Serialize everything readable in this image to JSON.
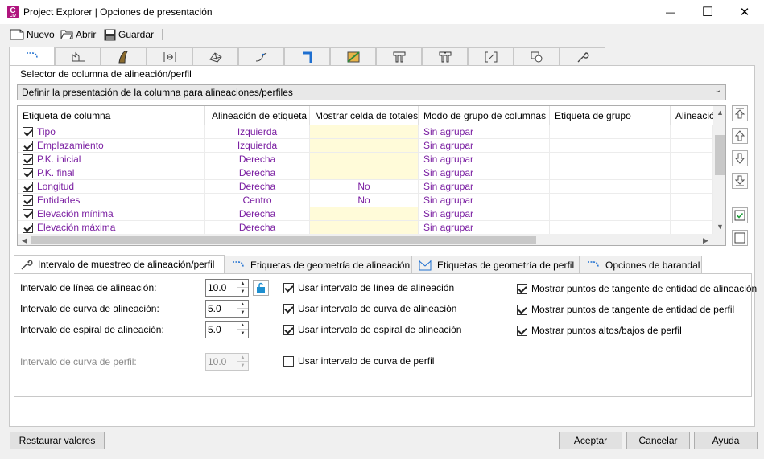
{
  "window": {
    "title": "Project Explorer | Opciones de presentación",
    "icon_letter": "C",
    "icon_sub": "CIV",
    "min_glyph": "—",
    "max_glyph": "☐",
    "close_glyph": "✕"
  },
  "toolbar": {
    "new_label": "Nuevo",
    "open_label": "Abrir",
    "save_label": "Guardar"
  },
  "main_tabs": [
    {
      "icon": "alignment-icon"
    },
    {
      "icon": "profile-icon"
    },
    {
      "icon": "corridor-icon"
    },
    {
      "icon": "sample-lines-icon"
    },
    {
      "icon": "surface-icon"
    },
    {
      "icon": "feature-line-icon"
    },
    {
      "icon": "pipe-network-icon"
    },
    {
      "icon": "parcel-icon"
    },
    {
      "icon": "structure-icon"
    },
    {
      "icon": "pressure-pipe-icon"
    },
    {
      "icon": "bracket-icon"
    },
    {
      "icon": "point-group-icon"
    },
    {
      "icon": "wrench-icon"
    }
  ],
  "column_selector": {
    "group_title": "Selector de columna de alineación/perfil",
    "dropdown_value": "Definir la presentación de la columna para alineaciones/perfiles"
  },
  "grid": {
    "headers": [
      "Etiqueta de columna",
      "Alineación de etiqueta",
      "Mostrar celda de totales",
      "Modo de grupo de columnas",
      "Etiqueta de grupo",
      "Alineació"
    ],
    "rows": [
      {
        "label": "Tipo",
        "align": "Izquierda",
        "totals": "",
        "group_mode": "Sin agrupar",
        "totals_yellow": true
      },
      {
        "label": "Emplazamiento",
        "align": "Izquierda",
        "totals": "",
        "group_mode": "Sin agrupar",
        "totals_yellow": true
      },
      {
        "label": "P.K. inicial",
        "align": "Derecha",
        "totals": "",
        "group_mode": "Sin agrupar",
        "totals_yellow": true
      },
      {
        "label": "P.K. final",
        "align": "Derecha",
        "totals": "",
        "group_mode": "Sin agrupar",
        "totals_yellow": true
      },
      {
        "label": "Longitud",
        "align": "Derecha",
        "totals": "No",
        "group_mode": "Sin agrupar",
        "totals_yellow": false
      },
      {
        "label": "Entidades",
        "align": "Centro",
        "totals": "No",
        "group_mode": "Sin agrupar",
        "totals_yellow": false
      },
      {
        "label": "Elevación mínima",
        "align": "Derecha",
        "totals": "",
        "group_mode": "Sin agrupar",
        "totals_yellow": true
      },
      {
        "label": "Elevación máxima",
        "align": "Derecha",
        "totals": "",
        "group_mode": "Sin agrupar",
        "totals_yellow": true
      }
    ],
    "text_color": "#7b1fa2",
    "yellow_cell_color": "#fffbd9"
  },
  "side_buttons": [
    "move-top-icon",
    "move-up-icon",
    "move-down-icon",
    "move-bottom-icon",
    "check-all-icon",
    "uncheck-all-icon"
  ],
  "sub_tabs": [
    {
      "label": "Intervalo de muestreo de alineación/perfil",
      "icon": "wrench-icon"
    },
    {
      "label": "Etiquetas de geometría de alineación",
      "icon": "alignment-icon"
    },
    {
      "label": "Etiquetas de geometría de perfil",
      "icon": "profile-icon"
    },
    {
      "label": "Opciones de barandal",
      "icon": "railing-icon"
    }
  ],
  "sampling": {
    "line_label": "Intervalo de línea de alineación:",
    "line_value": "10.0",
    "curve_label": "Intervalo de curva de alineación:",
    "curve_value": "5.0",
    "spiral_label": "Intervalo de espiral de alineación:",
    "spiral_value": "5.0",
    "profile_curve_label": "Intervalo de curva de perfil:",
    "profile_curve_value": "10.0",
    "use_line": "Usar intervalo de línea de alineación",
    "use_curve": "Usar intervalo de curva de alineación",
    "use_spiral": "Usar intervalo de espiral de alineación",
    "use_profile_curve": "Usar intervalo de curva de perfil",
    "show_alignment_tangent": "Mostrar puntos de tangente de entidad de alineación",
    "show_profile_tangent": "Mostrar puntos de tangente de entidad de perfil",
    "show_high_low": "Mostrar puntos altos/bajos de perfil"
  },
  "footer": {
    "reset_label": "Restaurar valores",
    "ok_label": "Aceptar",
    "cancel_label": "Cancelar",
    "help_label": "Ayuda"
  }
}
